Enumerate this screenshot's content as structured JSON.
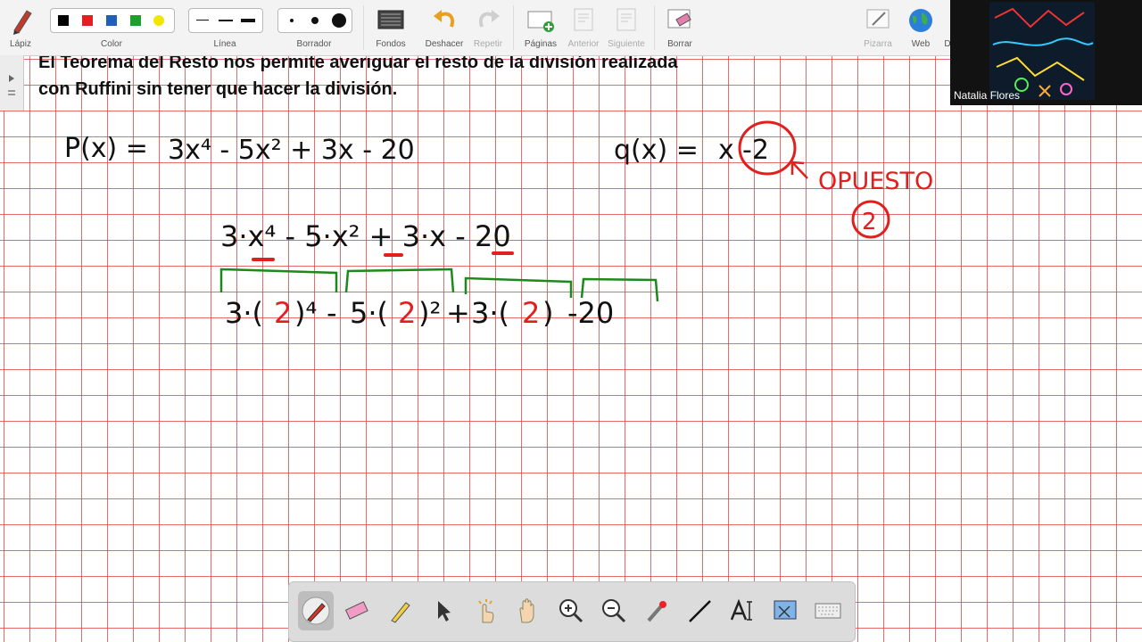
{
  "toolbar": {
    "pencil_label": "Lápiz",
    "color_label": "Color",
    "line_label": "Línea",
    "eraser_label": "Borrador",
    "backgrounds_label": "Fondos",
    "undo_label": "Deshacer",
    "redo_label": "Repetir",
    "pages_label": "Páginas",
    "prev_label": "Anterior",
    "next_label": "Siguiente",
    "clear_label": "Borrar",
    "whiteboard_label": "Pizarra",
    "web_label": "Web",
    "overflow_label": "D",
    "colors": [
      "#000000",
      "#e02020",
      "#1f5fb5",
      "#1e9e2c",
      "#f2e600"
    ]
  },
  "participant": {
    "name": "Natalia Flores"
  },
  "slide": {
    "heading_line1": "El Teorema del Resto nos permite averiguar el resto de la división realizada",
    "heading_line2": "con Ruffini sin tener que hacer la división."
  },
  "board": {
    "px_label": "P(x) =",
    "px_poly": "3x⁴ - 5x² + 3x - 20",
    "qx_label": "q(x) =",
    "qx_x": "x",
    "qx_circled": "-2",
    "opuesto_label": "OPUESTO",
    "opuesto_value": "2",
    "expanded_line1": "3·x⁴ - 5·x² + 3·x - 20",
    "eval_term1_prefix": "3·(",
    "eval_value": "2",
    "eval_term1_suffix": ")⁴",
    "eval_minus": "-",
    "eval_term2_prefix": "5·(",
    "eval_term2_suffix": ")²",
    "eval_plus": "+",
    "eval_term3_prefix": "3·(",
    "eval_term3_suffix": ")",
    "eval_term4": "-20",
    "ink_black": "#111111",
    "ink_red": "#e0201f",
    "ink_green": "#1b8a1b"
  },
  "bottom_tools": [
    "pen-tool",
    "eraser-tool",
    "highlighter-tool",
    "pointer-tool",
    "click-tool",
    "hand-tool",
    "zoom-in-tool",
    "zoom-out-tool",
    "laser-tool",
    "line-tool",
    "text-tool",
    "screenshot-tool",
    "keyboard-tool"
  ]
}
